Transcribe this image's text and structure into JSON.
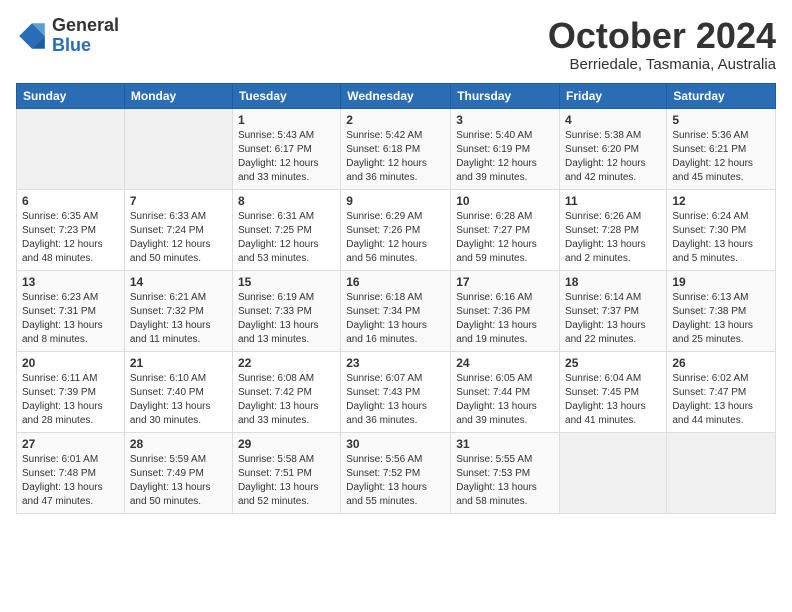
{
  "logo": {
    "general": "General",
    "blue": "Blue"
  },
  "title": "October 2024",
  "location": "Berriedale, Tasmania, Australia",
  "days_of_week": [
    "Sunday",
    "Monday",
    "Tuesday",
    "Wednesday",
    "Thursday",
    "Friday",
    "Saturday"
  ],
  "weeks": [
    [
      {
        "day": "",
        "info": ""
      },
      {
        "day": "",
        "info": ""
      },
      {
        "day": "1",
        "info": "Sunrise: 5:43 AM\nSunset: 6:17 PM\nDaylight: 12 hours\nand 33 minutes."
      },
      {
        "day": "2",
        "info": "Sunrise: 5:42 AM\nSunset: 6:18 PM\nDaylight: 12 hours\nand 36 minutes."
      },
      {
        "day": "3",
        "info": "Sunrise: 5:40 AM\nSunset: 6:19 PM\nDaylight: 12 hours\nand 39 minutes."
      },
      {
        "day": "4",
        "info": "Sunrise: 5:38 AM\nSunset: 6:20 PM\nDaylight: 12 hours\nand 42 minutes."
      },
      {
        "day": "5",
        "info": "Sunrise: 5:36 AM\nSunset: 6:21 PM\nDaylight: 12 hours\nand 45 minutes."
      }
    ],
    [
      {
        "day": "6",
        "info": "Sunrise: 6:35 AM\nSunset: 7:23 PM\nDaylight: 12 hours\nand 48 minutes."
      },
      {
        "day": "7",
        "info": "Sunrise: 6:33 AM\nSunset: 7:24 PM\nDaylight: 12 hours\nand 50 minutes."
      },
      {
        "day": "8",
        "info": "Sunrise: 6:31 AM\nSunset: 7:25 PM\nDaylight: 12 hours\nand 53 minutes."
      },
      {
        "day": "9",
        "info": "Sunrise: 6:29 AM\nSunset: 7:26 PM\nDaylight: 12 hours\nand 56 minutes."
      },
      {
        "day": "10",
        "info": "Sunrise: 6:28 AM\nSunset: 7:27 PM\nDaylight: 12 hours\nand 59 minutes."
      },
      {
        "day": "11",
        "info": "Sunrise: 6:26 AM\nSunset: 7:28 PM\nDaylight: 13 hours\nand 2 minutes."
      },
      {
        "day": "12",
        "info": "Sunrise: 6:24 AM\nSunset: 7:30 PM\nDaylight: 13 hours\nand 5 minutes."
      }
    ],
    [
      {
        "day": "13",
        "info": "Sunrise: 6:23 AM\nSunset: 7:31 PM\nDaylight: 13 hours\nand 8 minutes."
      },
      {
        "day": "14",
        "info": "Sunrise: 6:21 AM\nSunset: 7:32 PM\nDaylight: 13 hours\nand 11 minutes."
      },
      {
        "day": "15",
        "info": "Sunrise: 6:19 AM\nSunset: 7:33 PM\nDaylight: 13 hours\nand 13 minutes."
      },
      {
        "day": "16",
        "info": "Sunrise: 6:18 AM\nSunset: 7:34 PM\nDaylight: 13 hours\nand 16 minutes."
      },
      {
        "day": "17",
        "info": "Sunrise: 6:16 AM\nSunset: 7:36 PM\nDaylight: 13 hours\nand 19 minutes."
      },
      {
        "day": "18",
        "info": "Sunrise: 6:14 AM\nSunset: 7:37 PM\nDaylight: 13 hours\nand 22 minutes."
      },
      {
        "day": "19",
        "info": "Sunrise: 6:13 AM\nSunset: 7:38 PM\nDaylight: 13 hours\nand 25 minutes."
      }
    ],
    [
      {
        "day": "20",
        "info": "Sunrise: 6:11 AM\nSunset: 7:39 PM\nDaylight: 13 hours\nand 28 minutes."
      },
      {
        "day": "21",
        "info": "Sunrise: 6:10 AM\nSunset: 7:40 PM\nDaylight: 13 hours\nand 30 minutes."
      },
      {
        "day": "22",
        "info": "Sunrise: 6:08 AM\nSunset: 7:42 PM\nDaylight: 13 hours\nand 33 minutes."
      },
      {
        "day": "23",
        "info": "Sunrise: 6:07 AM\nSunset: 7:43 PM\nDaylight: 13 hours\nand 36 minutes."
      },
      {
        "day": "24",
        "info": "Sunrise: 6:05 AM\nSunset: 7:44 PM\nDaylight: 13 hours\nand 39 minutes."
      },
      {
        "day": "25",
        "info": "Sunrise: 6:04 AM\nSunset: 7:45 PM\nDaylight: 13 hours\nand 41 minutes."
      },
      {
        "day": "26",
        "info": "Sunrise: 6:02 AM\nSunset: 7:47 PM\nDaylight: 13 hours\nand 44 minutes."
      }
    ],
    [
      {
        "day": "27",
        "info": "Sunrise: 6:01 AM\nSunset: 7:48 PM\nDaylight: 13 hours\nand 47 minutes."
      },
      {
        "day": "28",
        "info": "Sunrise: 5:59 AM\nSunset: 7:49 PM\nDaylight: 13 hours\nand 50 minutes."
      },
      {
        "day": "29",
        "info": "Sunrise: 5:58 AM\nSunset: 7:51 PM\nDaylight: 13 hours\nand 52 minutes."
      },
      {
        "day": "30",
        "info": "Sunrise: 5:56 AM\nSunset: 7:52 PM\nDaylight: 13 hours\nand 55 minutes."
      },
      {
        "day": "31",
        "info": "Sunrise: 5:55 AM\nSunset: 7:53 PM\nDaylight: 13 hours\nand 58 minutes."
      },
      {
        "day": "",
        "info": ""
      },
      {
        "day": "",
        "info": ""
      }
    ]
  ]
}
